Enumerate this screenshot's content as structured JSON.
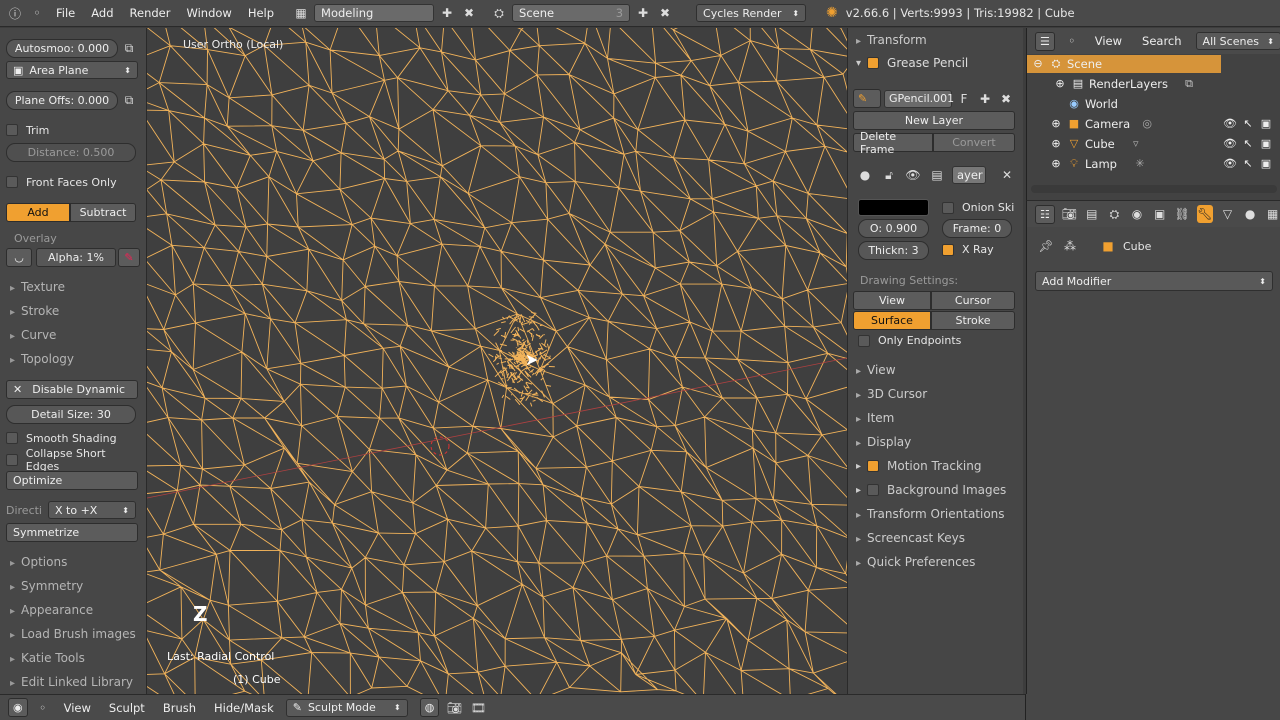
{
  "topbar": {
    "menus": [
      "File",
      "Add",
      "Render",
      "Window",
      "Help"
    ],
    "layout": "Modeling",
    "scene": "Scene",
    "scene_num": "3",
    "engine": "Cycles Render",
    "info": "v2.66.6 | Verts:9993 | Tris:19982 | Cube"
  },
  "tool": {
    "autosmooth": "Autosmoo: 0.000",
    "area_plane": "Area Plane",
    "plane_offset": "Plane Offs: 0.000",
    "trim": "Trim",
    "distance": "Distance: 0.500",
    "front_faces": "Front Faces Only",
    "add": "Add",
    "subtract": "Subtract",
    "overlay": "Overlay",
    "alpha": "Alpha: 1%",
    "texture": "Texture",
    "stroke": "Stroke",
    "curve": "Curve",
    "topology": "Topology",
    "disable_dynamic": "Disable Dynamic",
    "detail_size": "Detail Size: 30",
    "smooth_shading": "Smooth Shading",
    "collapse_edges": "Collapse Short Edges",
    "optimize": "Optimize",
    "direction_label": "Directi",
    "direction_value": "X to +X",
    "symmetrize": "Symmetrize",
    "options": "Options",
    "symmetry": "Symmetry",
    "appearance": "Appearance",
    "load_brush": "Load Brush images",
    "katie": "Katie Tools",
    "edit_linked": "Edit Linked Library"
  },
  "viewport": {
    "view_label": "User Ortho (Local)",
    "axis_label": "Z",
    "last_op": "Last: Radial Control",
    "object_label": "(1) Cube"
  },
  "npanel": {
    "transform": "Transform",
    "grease_pencil": "Grease Pencil",
    "gpencil_name": "GPencil.001",
    "gpencil_f": "F",
    "new_layer": "New Layer",
    "delete_frame": "Delete Frame",
    "convert": "Convert",
    "layer_name": "ayer",
    "onion": "Onion Ski",
    "opacity": "O: 0.900",
    "frame": "Frame: 0",
    "thickness": "Thickn: 3",
    "xray": "X Ray",
    "drawing_settings": "Drawing Settings:",
    "view_btn": "View",
    "cursor_btn": "Cursor",
    "surface_btn": "Surface",
    "stroke_btn": "Stroke",
    "only_endpoints": "Only Endpoints",
    "view": "View",
    "cursor3d": "3D Cursor",
    "item": "Item",
    "display": "Display",
    "motion_tracking": "Motion Tracking",
    "background_images": "Background Images",
    "transform_orient": "Transform Orientations",
    "screencast": "Screencast Keys",
    "quick_prefs": "Quick Preferences"
  },
  "outliner": {
    "view": "View",
    "search": "Search",
    "all_scenes": "All Scenes",
    "scene": "Scene",
    "renderlayers": "RenderLayers",
    "world": "World",
    "camera": "Camera",
    "cube": "Cube",
    "lamp": "Lamp"
  },
  "props": {
    "object": "Cube",
    "add_modifier": "Add Modifier"
  },
  "bottombar": {
    "view": "View",
    "sculpt": "Sculpt",
    "brush": "Brush",
    "hide_mask": "Hide/Mask",
    "mode": "Sculpt Mode"
  },
  "colors": {
    "accent": "#f0a030",
    "wire": "#f2b35a"
  }
}
